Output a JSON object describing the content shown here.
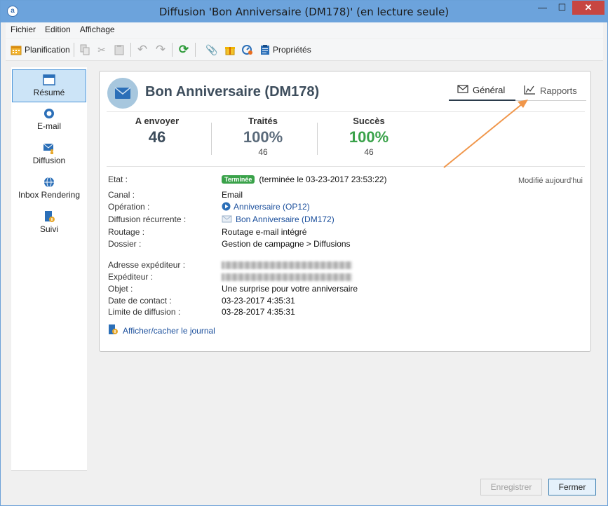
{
  "window": {
    "title": "Diffusion 'Bon Anniversaire (DM178)' (en lecture seule)",
    "min_glyph": "—",
    "max_glyph": "☐",
    "close_glyph": "✕",
    "app_letter": "a"
  },
  "menu": [
    "Fichier",
    "Edition",
    "Affichage"
  ],
  "toolbar": {
    "planification": "Planification",
    "proprietes": "Propriétés"
  },
  "sidebar": [
    {
      "label": "Résumé",
      "icon": "window-icon",
      "active": true
    },
    {
      "label": "E-mail",
      "icon": "lifebuoy-icon",
      "active": false
    },
    {
      "label": "Diffusion",
      "icon": "envelope-person-icon",
      "active": false
    },
    {
      "label": "Inbox Rendering",
      "icon": "globe-icon",
      "active": false
    },
    {
      "label": "Suivi",
      "icon": "doc-info-icon",
      "active": false
    }
  ],
  "header": {
    "title": "Bon Anniversaire (DM178)"
  },
  "tabs": {
    "general": "Général",
    "rapports": "Rapports"
  },
  "stats": {
    "a_envoyer": {
      "label": "A envoyer",
      "value": "46"
    },
    "traites": {
      "label": "Traités",
      "value": "100%",
      "sub": "46"
    },
    "succes": {
      "label": "Succès",
      "value": "100%",
      "sub": "46"
    }
  },
  "status": {
    "badge": "Terminée",
    "text": "(terminée le 03-23-2017 23:53:22)",
    "modified": "Modifié aujourd'hui"
  },
  "details": {
    "etat": "Etat :",
    "canal_k": "Canal :",
    "canal_v": "Email",
    "operation_k": "Opération :",
    "operation_v": "Anniversaire (OP12)",
    "recurrente_k": "Diffusion récurrente :",
    "recurrente_v": "Bon Anniversaire (DM172)",
    "routage_k": "Routage :",
    "routage_v": "Routage e-mail intégré",
    "dossier_k": "Dossier :",
    "dossier_v": "Gestion de campagne > Diffusions",
    "adresse_k": "Adresse expéditeur :",
    "expediteur_k": "Expéditeur :",
    "objet_k": "Objet :",
    "objet_v": "Une surprise pour votre anniversaire",
    "date_k": "Date de contact :",
    "date_v": "03-23-2017 4:35:31",
    "limite_k": "Limite de diffusion :",
    "limite_v": "03-28-2017 4:35:31"
  },
  "journal_link": "Afficher/cacher le journal",
  "buttons": {
    "enregistrer": "Enregistrer",
    "fermer": "Fermer"
  },
  "colors": {
    "success": "#3aa24a",
    "traites": "#5b6b7b",
    "accent_arrow": "#f0964a"
  }
}
